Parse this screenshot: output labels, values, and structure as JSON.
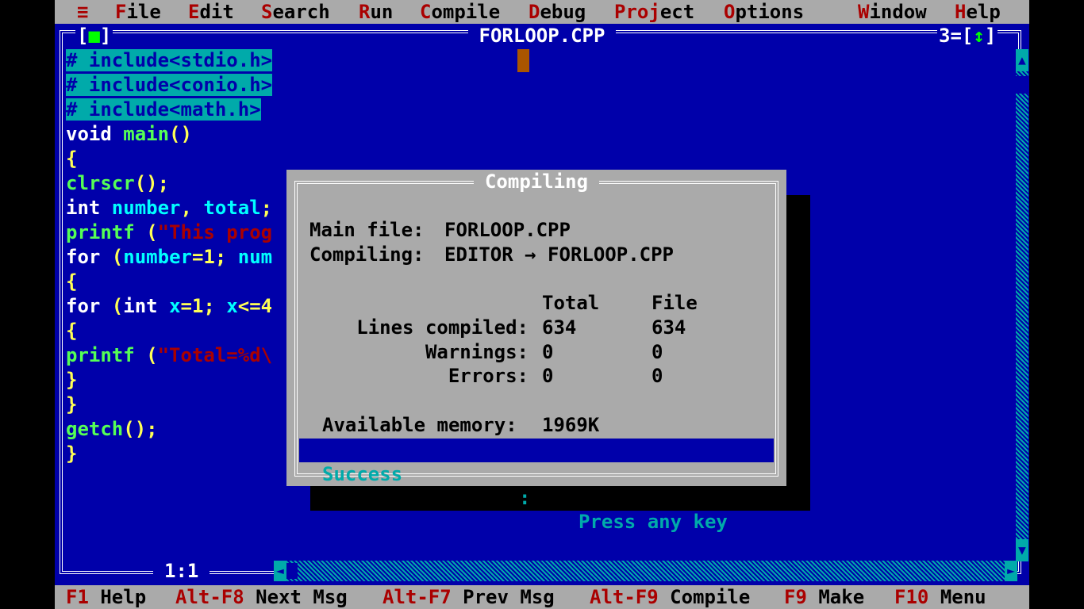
{
  "menu": {
    "system": "≡",
    "items": [
      {
        "hot": "F",
        "rest": "ile"
      },
      {
        "hot": "E",
        "rest": "dit"
      },
      {
        "hot": "S",
        "rest": "earch"
      },
      {
        "hot": "R",
        "rest": "un"
      },
      {
        "hot": "C",
        "rest": "ompile"
      },
      {
        "hot": "D",
        "rest": "ebug"
      },
      {
        "pre": "Pro",
        "hot": "j",
        "rest": "ect"
      },
      {
        "hot": "O",
        "rest": "ptions"
      },
      {
        "hot": "W",
        "rest": "indow"
      },
      {
        "hot": "H",
        "rest": "elp"
      }
    ]
  },
  "editor": {
    "title": "FORLOOP.CPP",
    "close_box": "[■]",
    "window_number": "3",
    "zoom_box": "[↕]",
    "position": "1:1",
    "lines": {
      "l1a": "# ",
      "l1b": "include<stdio.h>",
      "l2a": "# ",
      "l2b": "include<conio.h>",
      "l3a": "# ",
      "l3b": "include<math.h>",
      "l4a": "void",
      "l4b": " main",
      "l4c": "()",
      "l5": "{",
      "l6a": "clrscr",
      "l6b": "();",
      "l7a": "int",
      "l7b": " number",
      "l7c": ", ",
      "l7d": "total",
      "l7e": ";",
      "l8a": "printf",
      "l8b": " (",
      "l8c": "\"This prog",
      "l9a": "for",
      "l9b": " (",
      "l9c": "number",
      "l9d": "=1; ",
      "l9e": "num",
      "l10": "{",
      "l11a": "for",
      "l11b": " (",
      "l11c": "int",
      "l11d": " x",
      "l11e": "=1; ",
      "l11f": "x",
      "l11g": "<=4",
      "l12": "{",
      "l13a": "printf",
      "l13b": " (",
      "l13c": "\"Total=%d\\",
      "l14": "}",
      "l15": "}",
      "l16a": "getch",
      "l16b": "();",
      "l17": "}"
    }
  },
  "dialog": {
    "title": "Compiling",
    "main_file_label": "Main file:",
    "main_file": "FORLOOP.CPP",
    "compiling_label": "Compiling:",
    "compiling_value": "EDITOR → FORLOOP.CPP",
    "col_total": "Total",
    "col_file": "File",
    "rows": [
      {
        "label": "Lines compiled:",
        "total": "634",
        "file": "634"
      },
      {
        "label": "Warnings:",
        "total": "0",
        "file": "0"
      },
      {
        "label": "Errors:",
        "total": "0",
        "file": "0"
      }
    ],
    "memory_label": "Available memory:",
    "memory_value": "1969K",
    "status_left": "Success",
    "status_sep": ":",
    "status_right": "Press any key"
  },
  "hotkeys": [
    {
      "key": "F1",
      "label": "Help"
    },
    {
      "key": "Alt-F8",
      "label": "Next Msg"
    },
    {
      "key": "Alt-F7",
      "label": "Prev Msg"
    },
    {
      "key": "Alt-F9",
      "label": "Compile"
    },
    {
      "key": "F9",
      "label": "Make"
    },
    {
      "key": "F10",
      "label": "Menu"
    }
  ],
  "colors": {
    "desktop_blue": "#0000aa",
    "menu_gray": "#aaaaaa",
    "hotkey_red": "#aa0000",
    "selection_cyan": "#00aaaa",
    "cursor_orange": "#aa5500"
  }
}
